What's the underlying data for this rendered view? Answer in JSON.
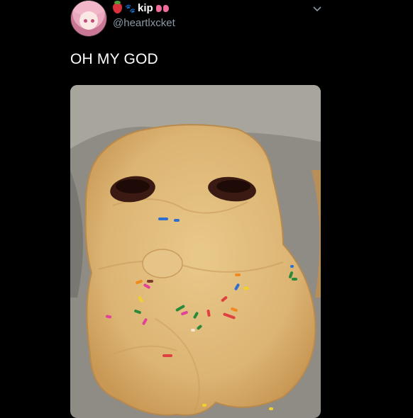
{
  "user": {
    "display_name": "kip",
    "handle": "@heartlxcket",
    "name_emojis": [
      "strawberry-icon",
      "paw-prints-icon",
      "bow-icon"
    ]
  },
  "tweet": {
    "text": "OH MY GOD"
  },
  "menu": {
    "icon": "chevron-down-icon"
  },
  "media": {
    "description_icon": "cookie-photo"
  }
}
